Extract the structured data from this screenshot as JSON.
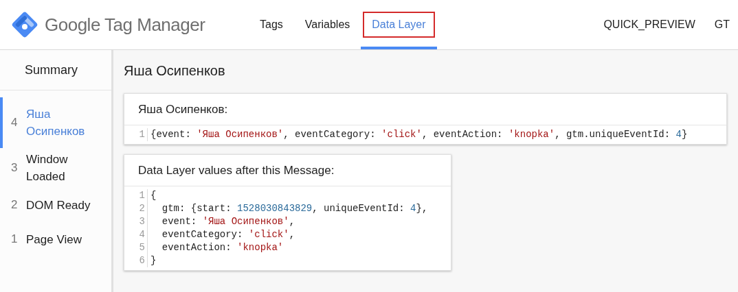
{
  "header": {
    "logo_text": "Google Tag Manager",
    "tabs": [
      {
        "label": "Tags",
        "selected": false,
        "highlighted": false
      },
      {
        "label": "Variables",
        "selected": false,
        "highlighted": false
      },
      {
        "label": "Data Layer",
        "selected": true,
        "highlighted": true
      }
    ],
    "right_items": [
      "QUICK_PREVIEW",
      "GT"
    ]
  },
  "sidebar": {
    "summary": "Summary",
    "items": [
      {
        "number": "4",
        "label": "Яша Осипенков",
        "selected": true
      },
      {
        "number": "3",
        "label": "Window Loaded",
        "selected": false
      },
      {
        "number": "2",
        "label": "DOM Ready",
        "selected": false
      },
      {
        "number": "1",
        "label": "Page View",
        "selected": false
      }
    ]
  },
  "main": {
    "title": "Яша Осипенков",
    "cards": [
      {
        "title": "Яша Осипенков:",
        "lines": [
          {
            "number": "1",
            "segments": [
              {
                "kind": "plain",
                "text": "{event: "
              },
              {
                "kind": "string",
                "text": "'Яша Осипенков'"
              },
              {
                "kind": "plain",
                "text": ", eventCategory: "
              },
              {
                "kind": "string",
                "text": "'click'"
              },
              {
                "kind": "plain",
                "text": ", eventAction: "
              },
              {
                "kind": "string",
                "text": "'knopka'"
              },
              {
                "kind": "plain",
                "text": ", gtm.uniqueEventId: "
              },
              {
                "kind": "number",
                "text": "4"
              },
              {
                "kind": "plain",
                "text": "}"
              }
            ]
          }
        ]
      },
      {
        "title": "Data Layer values after this Message:",
        "lines": [
          {
            "number": "1",
            "segments": [
              {
                "kind": "plain",
                "text": "{"
              }
            ]
          },
          {
            "number": "2",
            "segments": [
              {
                "kind": "plain",
                "text": "  gtm: {start: "
              },
              {
                "kind": "number",
                "text": "1528030843829"
              },
              {
                "kind": "plain",
                "text": ", uniqueEventId: "
              },
              {
                "kind": "number",
                "text": "4"
              },
              {
                "kind": "plain",
                "text": "},"
              }
            ]
          },
          {
            "number": "3",
            "segments": [
              {
                "kind": "plain",
                "text": "  event: "
              },
              {
                "kind": "string",
                "text": "'Яша Осипенков'"
              },
              {
                "kind": "plain",
                "text": ","
              }
            ]
          },
          {
            "number": "4",
            "segments": [
              {
                "kind": "plain",
                "text": "  eventCategory: "
              },
              {
                "kind": "string",
                "text": "'click'"
              },
              {
                "kind": "plain",
                "text": ","
              }
            ]
          },
          {
            "number": "5",
            "segments": [
              {
                "kind": "plain",
                "text": "  eventAction: "
              },
              {
                "kind": "string",
                "text": "'knopka'"
              }
            ]
          },
          {
            "number": "6",
            "segments": [
              {
                "kind": "plain",
                "text": "}"
              }
            ]
          }
        ]
      }
    ]
  }
}
